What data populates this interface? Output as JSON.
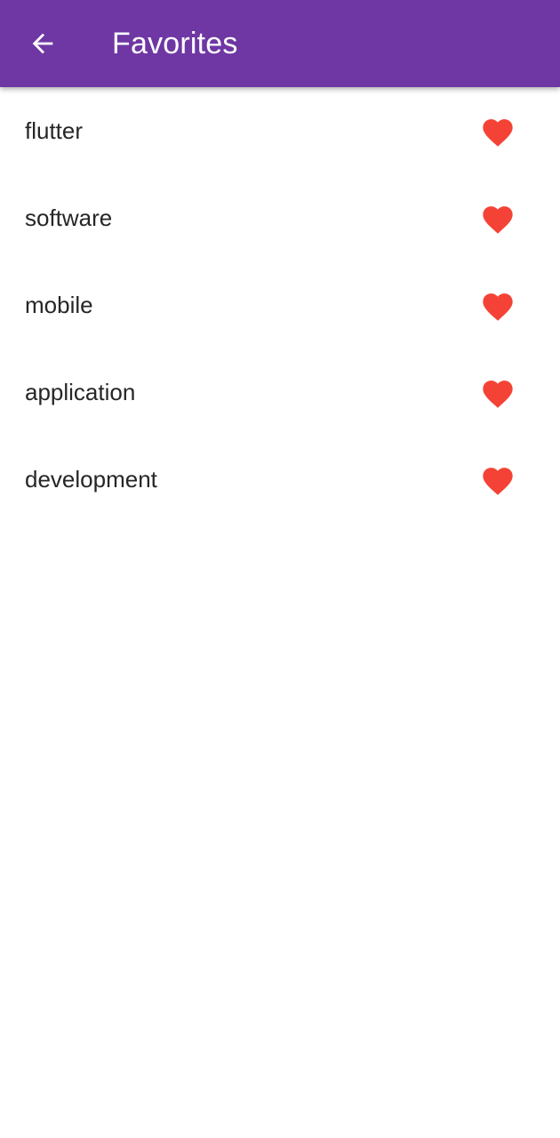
{
  "appbar": {
    "title": "Favorites",
    "back_icon": "arrow-back-icon",
    "background_color": "#6f37a3"
  },
  "favorites": [
    {
      "label": "flutter",
      "icon": "heart-icon"
    },
    {
      "label": "software",
      "icon": "heart-icon"
    },
    {
      "label": "mobile",
      "icon": "heart-icon"
    },
    {
      "label": "application",
      "icon": "heart-icon"
    },
    {
      "label": "development",
      "icon": "heart-icon"
    }
  ],
  "colors": {
    "heart": "#f44336",
    "text": "#262626"
  }
}
